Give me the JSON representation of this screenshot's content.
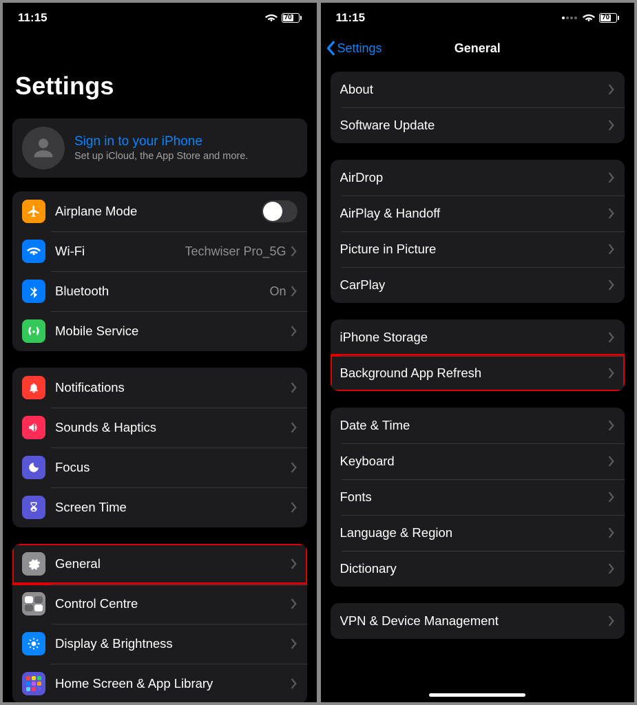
{
  "status": {
    "time": "11:15",
    "battery": "70"
  },
  "left": {
    "title": "Settings",
    "signin": {
      "title": "Sign in to your iPhone",
      "subtitle": "Set up iCloud, the App Store and more."
    },
    "group1": [
      {
        "icon": "airplane",
        "label": "Airplane Mode",
        "control": "toggle"
      },
      {
        "icon": "wifi",
        "label": "Wi-Fi",
        "value": "Techwiser Pro_5G"
      },
      {
        "icon": "bluetooth",
        "label": "Bluetooth",
        "value": "On"
      },
      {
        "icon": "mobile",
        "label": "Mobile Service"
      }
    ],
    "group2": [
      {
        "icon": "bell",
        "label": "Notifications"
      },
      {
        "icon": "speaker",
        "label": "Sounds & Haptics"
      },
      {
        "icon": "moon",
        "label": "Focus"
      },
      {
        "icon": "hourglass",
        "label": "Screen Time"
      }
    ],
    "group3": [
      {
        "icon": "gear",
        "label": "General",
        "highlight": true
      },
      {
        "icon": "cc",
        "label": "Control Centre"
      },
      {
        "icon": "sun",
        "label": "Display & Brightness"
      },
      {
        "icon": "grid",
        "label": "Home Screen & App Library"
      }
    ]
  },
  "right": {
    "back": "Settings",
    "title": "General",
    "g1": [
      {
        "label": "About"
      },
      {
        "label": "Software Update"
      }
    ],
    "g2": [
      {
        "label": "AirDrop"
      },
      {
        "label": "AirPlay & Handoff"
      },
      {
        "label": "Picture in Picture"
      },
      {
        "label": "CarPlay"
      }
    ],
    "g3": [
      {
        "label": "iPhone Storage"
      },
      {
        "label": "Background App Refresh",
        "highlight": true
      }
    ],
    "g4": [
      {
        "label": "Date & Time"
      },
      {
        "label": "Keyboard"
      },
      {
        "label": "Fonts"
      },
      {
        "label": "Language & Region"
      },
      {
        "label": "Dictionary"
      }
    ],
    "g5": [
      {
        "label": "VPN & Device Management"
      }
    ]
  }
}
